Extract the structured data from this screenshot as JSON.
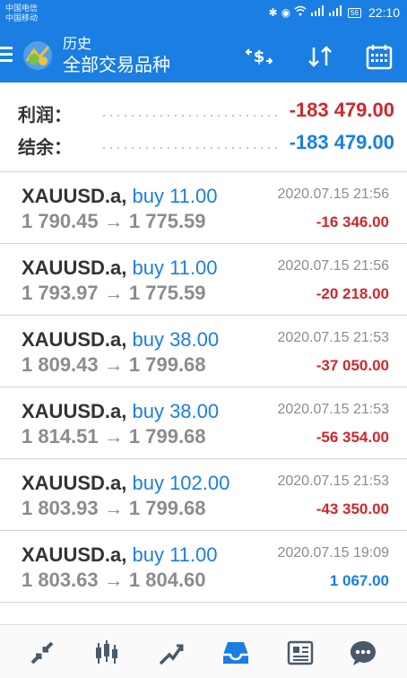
{
  "status_bar": {
    "carrier_1": "中国电信",
    "carrier_2": "中国移动",
    "battery": "56",
    "time": "22:10"
  },
  "app_bar": {
    "title": "历史",
    "subtitle": "全部交易品种",
    "icons": [
      "menu-icon",
      "metatrader-logo",
      "money-transfer-icon",
      "sort-icon",
      "calendar-icon"
    ]
  },
  "summary": {
    "profit_label": "利润：",
    "profit_value": "-183 479.00",
    "balance_label": "结余：",
    "balance_value": "-183 479.00"
  },
  "trades": [
    {
      "symbol": "XAUUSD.a,",
      "side": "buy 11.00",
      "open_price": "1 790.45",
      "arrow": "→",
      "close_price": "1 775.59",
      "datetime": "2020.07.15 21:56",
      "profit": "-16 346.00",
      "profit_sign": "neg"
    },
    {
      "symbol": "XAUUSD.a,",
      "side": "buy 11.00",
      "open_price": "1 793.97",
      "arrow": "→",
      "close_price": "1 775.59",
      "datetime": "2020.07.15 21:56",
      "profit": "-20 218.00",
      "profit_sign": "neg"
    },
    {
      "symbol": "XAUUSD.a,",
      "side": "buy 38.00",
      "open_price": "1 809.43",
      "arrow": "→",
      "close_price": "1 799.68",
      "datetime": "2020.07.15 21:53",
      "profit": "-37 050.00",
      "profit_sign": "neg"
    },
    {
      "symbol": "XAUUSD.a,",
      "side": "buy 38.00",
      "open_price": "1 814.51",
      "arrow": "→",
      "close_price": "1 799.68",
      "datetime": "2020.07.15 21:53",
      "profit": "-56 354.00",
      "profit_sign": "neg"
    },
    {
      "symbol": "XAUUSD.a,",
      "side": "buy 102.00",
      "open_price": "1 803.93",
      "arrow": "→",
      "close_price": "1 799.68",
      "datetime": "2020.07.15 21:53",
      "profit": "-43 350.00",
      "profit_sign": "neg"
    },
    {
      "symbol": "XAUUSD.a,",
      "side": "buy 11.00",
      "open_price": "1 803.63",
      "arrow": "→",
      "close_price": "1 804.60",
      "datetime": "2020.07.15 19:09",
      "profit": "1 067.00",
      "profit_sign": "pos"
    }
  ],
  "bottom_nav": {
    "items": [
      "quotes-icon",
      "chart-icon",
      "trade-icon",
      "history-icon",
      "news-icon",
      "chat-icon"
    ],
    "active": "history-icon"
  },
  "colors": {
    "accent": "#1a7ee3",
    "negative": "#d0272c",
    "muted": "#8c8c8c",
    "nav_icon": "#4a5a6a"
  }
}
